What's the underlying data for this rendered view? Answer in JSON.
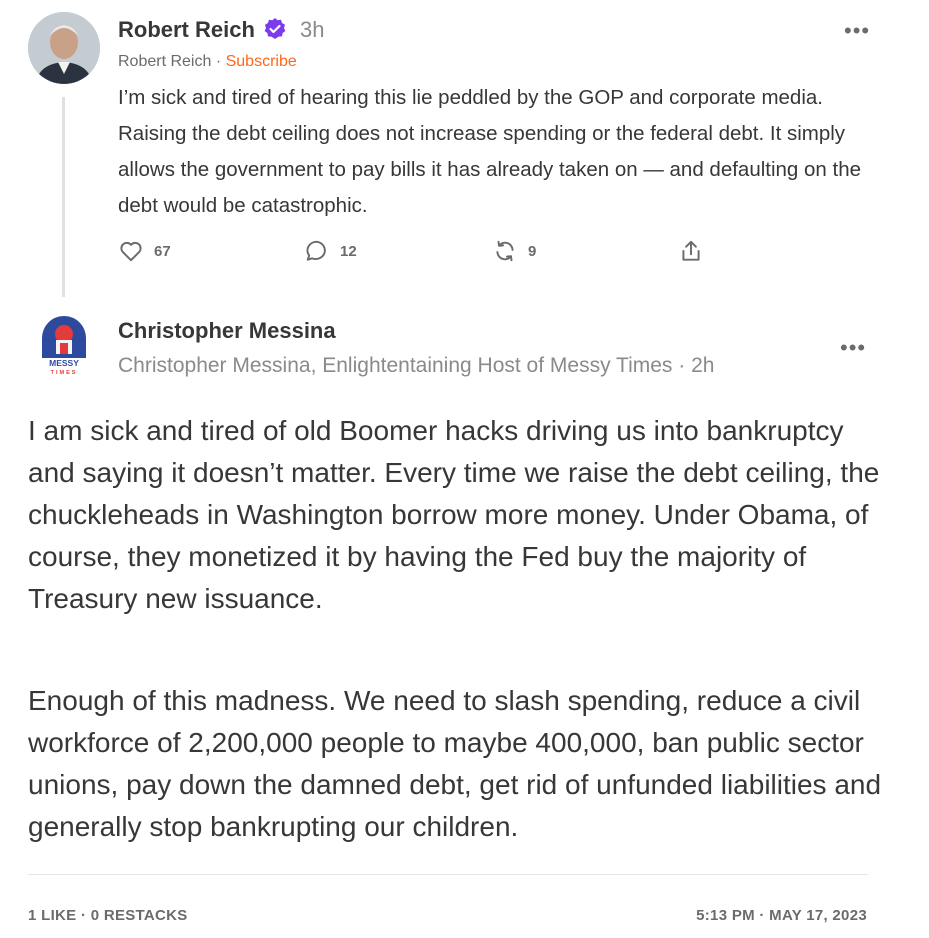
{
  "note1": {
    "author": "Robert Reich",
    "time": "3h",
    "publication": "Robert Reich",
    "separator": "·",
    "subscribe": "Subscribe",
    "more": "•••",
    "text": "I’m sick and tired of hearing this lie peddled by the GOP and corporate media. Raising the debt ceiling does not increase spending or the federal debt. It simply allows the government to pay bills it has already taken on — and defaulting on the debt would be catastrophic.",
    "likes": "67",
    "comments": "12",
    "restacks": "9"
  },
  "note2": {
    "author": "Christopher Messina",
    "byline": "Christopher Messina, Enlightentaining Host of Messy Times · 2h",
    "logo_text_top": "MESSY",
    "logo_text_bottom": "TIMES",
    "more": "•••",
    "paragraph1": "I am sick and tired of old Boomer hacks driving us into bankruptcy and saying it doesn’t matter.   Every time we raise the debt ceiling, the chuckleheads in Washington borrow more money.  Under Obama, of course, they monetized it by having the Fed buy the majority of Treasury new issuance.",
    "paragraph2": "Enough of this madness.  We need to slash spending, reduce a civil workforce of 2,200,000 people to maybe 400,000, ban public sector unions, pay down the damned debt, get rid of unfunded liabilities and generally stop bankrupting our children."
  },
  "footer": {
    "stats": "1 LIKE · 0 RESTACKS",
    "timestamp": "5:13 PM · MAY 17, 2023"
  },
  "colors": {
    "accent": "#ff6719",
    "verified": "#7c3aed",
    "text": "#363737",
    "muted": "#8a8a8a"
  },
  "icons": {
    "like": "heart-icon",
    "comment": "comment-bubble-icon",
    "restack": "restack-arrows-icon",
    "share": "share-upload-icon",
    "verified": "verified-check-icon",
    "more": "more-dots-icon"
  }
}
